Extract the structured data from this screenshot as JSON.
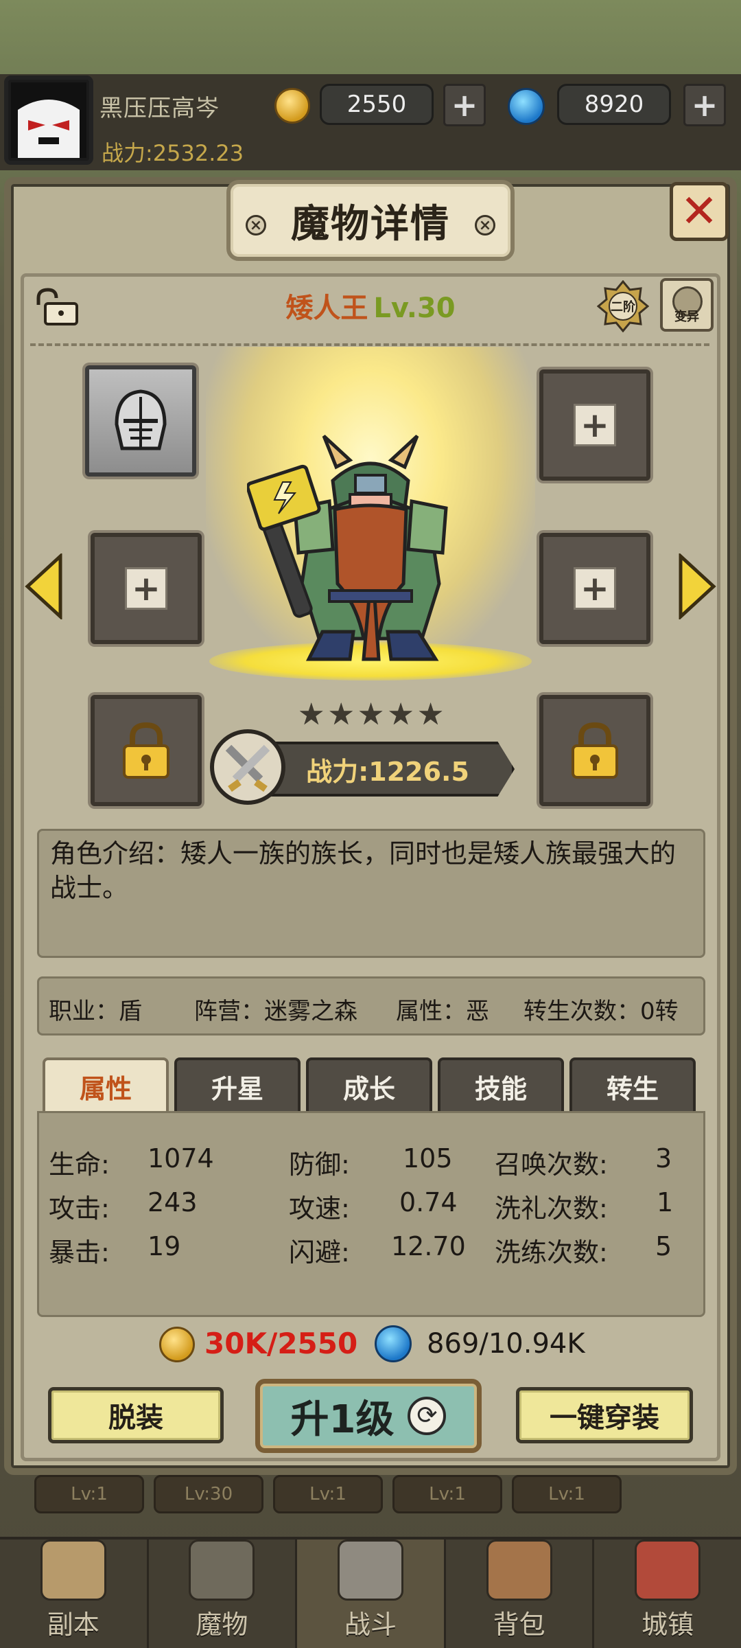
{
  "player": {
    "name": "黑压压高岑",
    "power": "战力:2532.23",
    "gold": "2550",
    "gems": "8920"
  },
  "modal": {
    "title": "魔物详情",
    "monster_name": "矮人王",
    "monster_level": "Lv.30",
    "tier_badge": "二阶",
    "mutate_label": "变异",
    "power": "战力:1226.5",
    "stars": 5,
    "intro": "角色介绍：矮人一族的族长，同时也是矮人族最强大的战士。",
    "info": {
      "job": "职业：盾",
      "camp": "阵营：迷雾之森",
      "attr": "属性：恶",
      "rebirth": "转生次数：0转"
    },
    "tabs": [
      "属性",
      "升星",
      "成长",
      "技能",
      "转生"
    ],
    "active_tab": 0,
    "stats": [
      {
        "label": "生命:",
        "value": "1074"
      },
      {
        "label": "攻击:",
        "value": "243"
      },
      {
        "label": "暴击:",
        "value": "19"
      },
      {
        "label": "防御:",
        "value": "105"
      },
      {
        "label": "攻速:",
        "value": "0.74"
      },
      {
        "label": "闪避:",
        "value": "12.70"
      },
      {
        "label": "召唤次数:",
        "value": "3"
      },
      {
        "label": "洗礼次数:",
        "value": "1"
      },
      {
        "label": "洗练次数:",
        "value": "5"
      }
    ],
    "cost_gold": "30K/2550",
    "cost_gem": "869/10.94K",
    "buttons": {
      "unequip": "脱装",
      "upgrade": "升1级",
      "equip_all": "一键穿装"
    }
  },
  "bottom_strip": [
    "Lv:1",
    "Lv:30",
    "Lv:1",
    "Lv:1",
    "Lv:1"
  ],
  "nav": [
    "副本",
    "魔物",
    "战斗",
    "背包",
    "城镇"
  ],
  "nav_active": 2,
  "colors": {
    "name_orange": "#c0531b",
    "level_green": "#7a9a22",
    "cost_red": "#d51e16",
    "power_gold": "#f0d27a"
  }
}
